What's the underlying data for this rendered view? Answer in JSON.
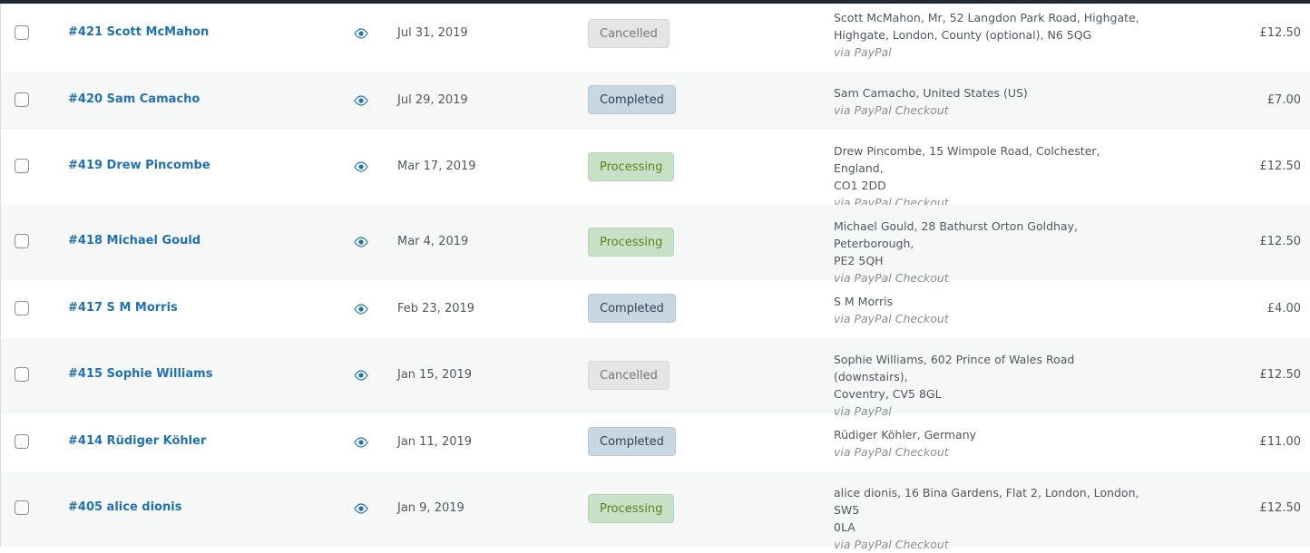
{
  "orders": [
    {
      "order": "#421 Scott McMahon",
      "date": "Jul 31, 2019",
      "status": "Cancelled",
      "address_line1": "Scott McMahon, Mr, 52 Langdon Park Road, Highgate,",
      "address_line2": "Highgate, London, County (optional), N6 5QG",
      "via": "via PayPal",
      "total": "£12.50"
    },
    {
      "order": "#420 Sam Camacho",
      "date": "Jul 29, 2019",
      "status": "Completed",
      "address_line1": "Sam Camacho, United States (US)",
      "address_line2": "",
      "via": "via PayPal Checkout",
      "total": "£7.00"
    },
    {
      "order": "#419 Drew Pincombe",
      "date": "Mar 17, 2019",
      "status": "Processing",
      "address_line1": "Drew Pincombe, 15 Wimpole Road, Colchester, England,",
      "address_line2": "CO1 2DD",
      "via": "via PayPal Checkout",
      "total": "£12.50"
    },
    {
      "order": "#418 Michael Gould",
      "date": "Mar 4, 2019",
      "status": "Processing",
      "address_line1": "Michael Gould, 28 Bathurst Orton Goldhay, Peterborough,",
      "address_line2": "PE2 5QH",
      "via": "via PayPal Checkout",
      "total": "£12.50"
    },
    {
      "order": "#417 S M Morris",
      "date": "Feb 23, 2019",
      "status": "Completed",
      "address_line1": "S M Morris",
      "address_line2": "",
      "via": "via PayPal Checkout",
      "total": "£4.00"
    },
    {
      "order": "#415 Sophie Williams",
      "date": "Jan 15, 2019",
      "status": "Cancelled",
      "address_line1": "Sophie Williams, 602 Prince of Wales Road (downstairs),",
      "address_line2": "Coventry, CV5 8GL",
      "via": "via PayPal",
      "total": "£12.50"
    },
    {
      "order": "#414 Rüdiger Köhler",
      "date": "Jan 11, 2019",
      "status": "Completed",
      "address_line1": "Rüdiger Köhler, Germany",
      "address_line2": "",
      "via": "via PayPal Checkout",
      "total": "£11.00"
    },
    {
      "order": "#405 alice dionis",
      "date": "Jan 9, 2019",
      "status": "Processing",
      "address_line1": "alice dionis, 16 Bina Gardens, Flat 2, London, London, SW5",
      "address_line2": "0LA",
      "via": "via PayPal Checkout",
      "total": "£12.50"
    }
  ],
  "colors": {
    "link": "#2271b1",
    "cancelled_bg": "#e5e5e5",
    "completed_bg": "#c8d7e1",
    "processing_bg": "#c6e1c6"
  },
  "icons": {
    "preview": "eye-icon"
  }
}
